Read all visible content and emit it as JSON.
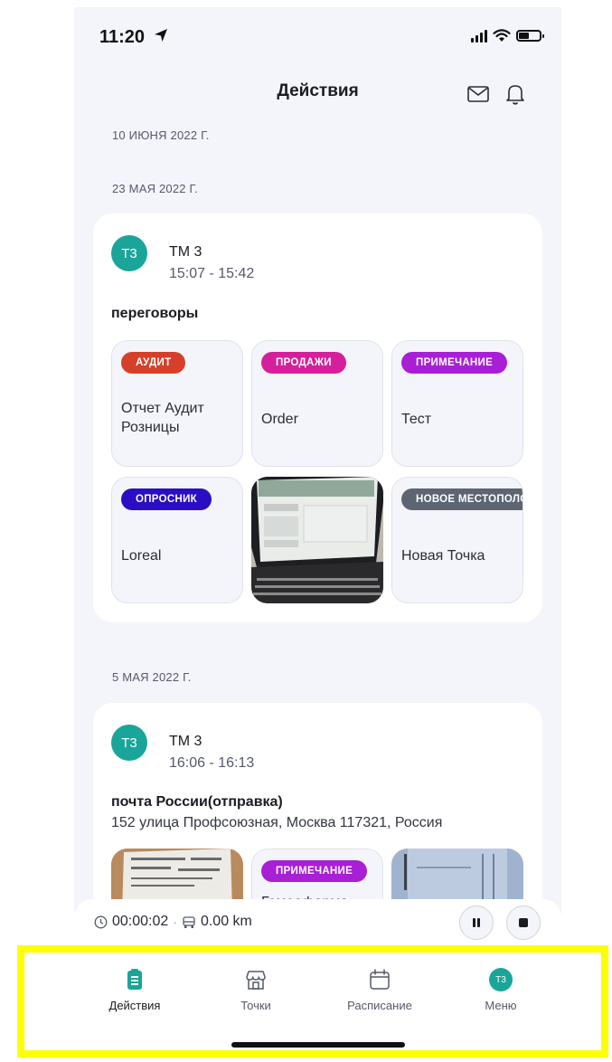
{
  "status_bar": {
    "time": "11:20"
  },
  "header": {
    "title": "Действия",
    "mail_icon": "mail-icon",
    "bell_icon": "bell-icon"
  },
  "dates": [
    "10 ИЮНЯ 2022 Г.",
    "23 МАЯ 2022 Г.",
    "5 МАЯ 2022 Г."
  ],
  "cards": [
    {
      "avatar": "Т3",
      "user": "ТМ 3",
      "time_range": "15:07 - 15:42",
      "title": "переговоры",
      "tiles": [
        {
          "badge": "АУДИТ",
          "badge_color": "#d6402a",
          "label": "Отчет Аудит Розницы"
        },
        {
          "badge": "ПРОДАЖИ",
          "badge_color": "#d61f9b",
          "label": "Order"
        },
        {
          "badge": "ПРИМЕЧАНИЕ",
          "badge_color": "#a81fd6",
          "label": "Тест"
        },
        {
          "badge": "ОПРОСНИК",
          "badge_color": "#2a0dc4",
          "label": "Loreal"
        },
        {
          "photo": "laptop-photo"
        },
        {
          "badge": "НОВОЕ МЕСТОПОЛОЖЕНИЕ",
          "badge_color": "#5d6573",
          "label": "Новая Точка"
        }
      ]
    },
    {
      "avatar": "Т3",
      "user": "ТМ 3",
      "time_range": "16:06 - 16:13",
      "title": "почта России(отправка)",
      "address": "152 улица Профсоюзная, Москва 117321, Россия",
      "tiles": [
        {
          "photo": "receipt-photo"
        },
        {
          "badge": "ПРИМЕЧАНИЕ",
          "badge_color": "#a81fd6",
          "label": "Гомеофарма"
        },
        {
          "photo": "document-photo"
        }
      ]
    }
  ],
  "tracker": {
    "duration": "00:00:02",
    "distance": "0.00 km"
  },
  "tabbar": {
    "items": [
      {
        "label": "Действия",
        "icon": "clipboard-icon",
        "active": true
      },
      {
        "label": "Точки",
        "icon": "shop-icon"
      },
      {
        "label": "Расписание",
        "icon": "calendar-icon"
      },
      {
        "label": "Меню",
        "icon": "avatar",
        "avatar": "Т3"
      }
    ]
  },
  "colors": {
    "accent": "#1aa59a",
    "highlight": "#ffff00",
    "background": "#f4f5fa"
  }
}
